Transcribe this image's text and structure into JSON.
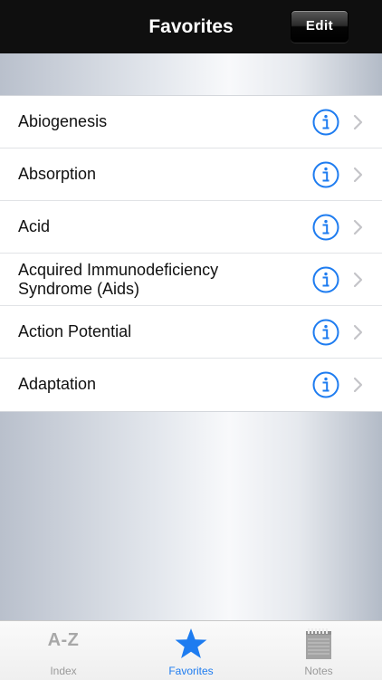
{
  "navbar": {
    "title": "Favorites",
    "edit_label": "Edit"
  },
  "list": {
    "items": [
      {
        "label": "Abiogenesis"
      },
      {
        "label": "Absorption"
      },
      {
        "label": "Acid"
      },
      {
        "label": "Acquired Immunodeficiency Syndrome (Aids)"
      },
      {
        "label": "Action Potential"
      },
      {
        "label": "Adaptation"
      }
    ]
  },
  "tabbar": {
    "tabs": [
      {
        "label": "Index",
        "icon_text": "A-Z",
        "icon": "az-icon"
      },
      {
        "label": "Favorites",
        "icon": "star-icon",
        "active": true
      },
      {
        "label": "Notes",
        "icon": "notepad-icon"
      }
    ]
  },
  "colors": {
    "accent": "#1e7cf0",
    "navbar": "#0f0f0f",
    "info_icon": "#1e7cf0",
    "inactive_tab": "#9a9a9a"
  }
}
